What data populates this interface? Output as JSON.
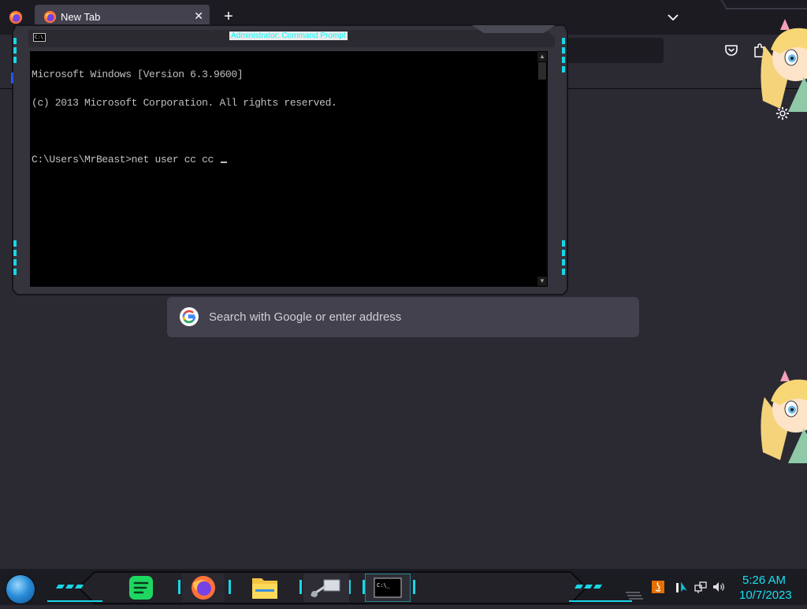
{
  "browser": {
    "tab": {
      "title": "New Tab"
    },
    "new_tab_symbol": "+",
    "close_symbol": "✕",
    "search": {
      "placeholder": "Search with Google or enter address"
    }
  },
  "cmd": {
    "title": "Administrator: Command Prompt",
    "icon_text": "C:\\",
    "lines": [
      "Microsoft Windows [Version 6.3.9600]",
      "(c) 2013 Microsoft Corporation. All rights reserved.",
      "",
      "C:\\Users\\MrBeast>net user cc cc "
    ]
  },
  "taskbar": {
    "apps": [
      {
        "name": "spotify-icon"
      },
      {
        "name": "firefox-icon"
      },
      {
        "name": "file-explorer-icon"
      },
      {
        "name": "network-app-icon"
      },
      {
        "name": "command-prompt-icon"
      }
    ],
    "clock": {
      "time": "5:26 AM",
      "date": "10/7/2023"
    }
  },
  "colors": {
    "accent": "#18e0f0",
    "browser_bg": "#2b2a33",
    "tabbar_bg": "#1c1b22",
    "console_bg": "#000000",
    "console_fg": "#c0c0c0"
  }
}
